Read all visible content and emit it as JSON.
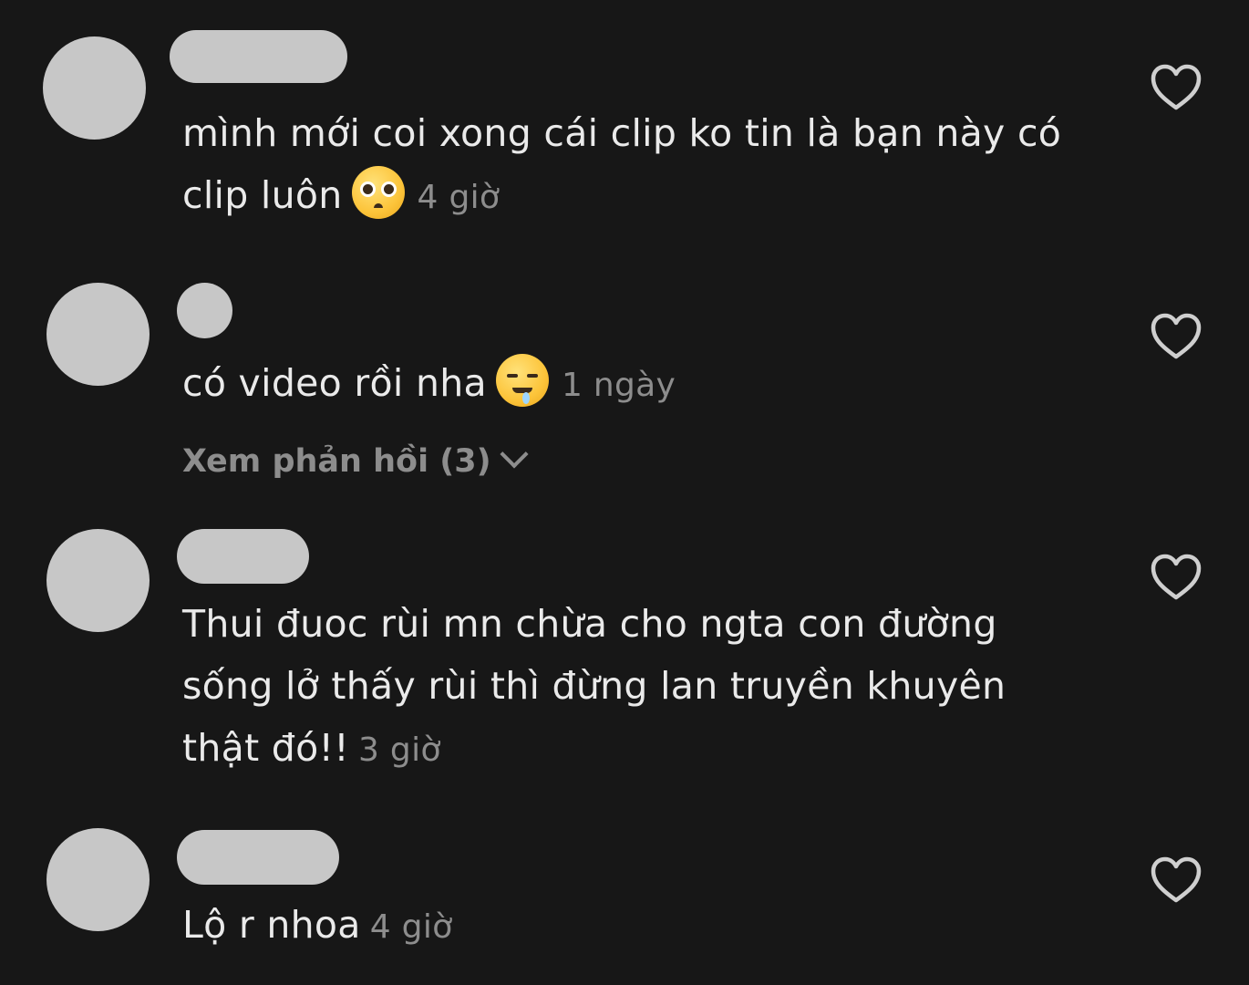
{
  "comments": [
    {
      "text": "mình mới coi xong cái clip ko tin là bạn này có clip luôn",
      "line1": "mình mới coi xong cái clip ko tin là bạn này có",
      "line2": "clip luôn",
      "emoji": "pleading-face",
      "time": "4 giờ"
    },
    {
      "text": "có video rồi nha",
      "emoji": "drooling-face",
      "time": "1 ngày",
      "replies_label": "Xem phản hồi (3)"
    },
    {
      "text": "Thui đuoc rùi mn chừa cho ngta con đường sống lở thấy rùi thì đừng lan truyền khuyên thật đó!!",
      "line1": "Thui đuoc rùi mn chừa cho ngta con đường",
      "line2": "sống lở thấy rùi thì đừng lan truyền khuyên",
      "line3": "thật đó!!",
      "time": "3 giờ"
    },
    {
      "text": "Lộ r nhoa",
      "time": "4 giờ"
    }
  ],
  "icons": {
    "like": "heart-outline-icon",
    "expand": "chevron-down-icon"
  },
  "colors": {
    "background": "#171717",
    "text": "#eaeaea",
    "muted": "#8d8d8d",
    "avatar": "#c7c7c7"
  }
}
